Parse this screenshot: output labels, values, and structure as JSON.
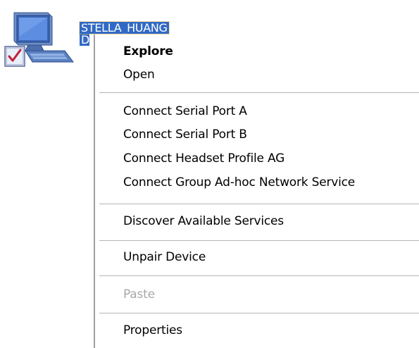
{
  "device": {
    "icon": "bluetooth-computer-icon",
    "name": "STELLA_HUANG",
    "sub_label": "De"
  },
  "context_menu": {
    "items": [
      {
        "label": "Explore",
        "bold": true,
        "enabled": true
      },
      {
        "label": "Open",
        "bold": false,
        "enabled": true
      },
      {
        "label": "Connect Serial Port A",
        "bold": false,
        "enabled": true
      },
      {
        "label": "Connect Serial Port B",
        "bold": false,
        "enabled": true
      },
      {
        "label": "Connect Headset Profile AG",
        "bold": false,
        "enabled": true
      },
      {
        "label": "Connect Group Ad-hoc Network Service",
        "bold": false,
        "enabled": true
      },
      {
        "label": "Discover Available Services",
        "bold": false,
        "enabled": true
      },
      {
        "label": "Unpair Device",
        "bold": false,
        "enabled": true
      },
      {
        "label": "Paste",
        "bold": false,
        "enabled": false
      },
      {
        "label": "Properties",
        "bold": false,
        "enabled": true
      }
    ]
  },
  "colors": {
    "selection": "#316ac5",
    "disabled_text": "#a8a8a8",
    "separator": "#b5b5b5"
  }
}
